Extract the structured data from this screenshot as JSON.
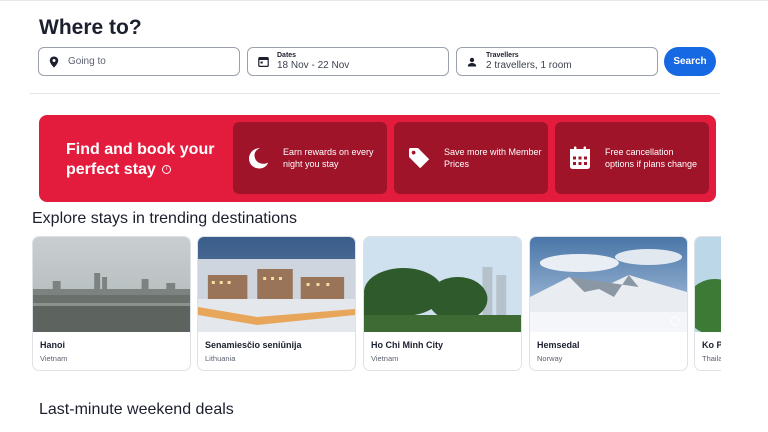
{
  "page_title": "Where to?",
  "search": {
    "going_to_placeholder": "Going to",
    "dates_label": "Dates",
    "dates_value": "18 Nov - 22 Nov",
    "travellers_label": "Travellers",
    "travellers_value": "2 travellers, 1 room",
    "search_button": "Search"
  },
  "banner": {
    "title": "Find and book your perfect stay",
    "perks": [
      {
        "icon": "moon-icon",
        "text": "Earn rewards on every night you stay"
      },
      {
        "icon": "tag-icon",
        "text": "Save more with Member Prices"
      },
      {
        "icon": "calendar-icon",
        "text": "Free cancellation options if plans change"
      }
    ]
  },
  "trending": {
    "title": "Explore stays in trending destinations",
    "destinations": [
      {
        "name": "Hanoi",
        "country": "Vietnam"
      },
      {
        "name": "Senamiesčio seniūnija",
        "country": "Lithuania"
      },
      {
        "name": "Ho Chi Minh City",
        "country": "Vietnam"
      },
      {
        "name": "Hemsedal",
        "country": "Norway"
      },
      {
        "name": "Ko Pl",
        "country": "Thaila"
      }
    ]
  },
  "deals": {
    "title": "Last-minute weekend deals"
  },
  "colors": {
    "accent": "#1668e3",
    "banner": "#e31c3d",
    "perk_box": "#a0142a"
  }
}
